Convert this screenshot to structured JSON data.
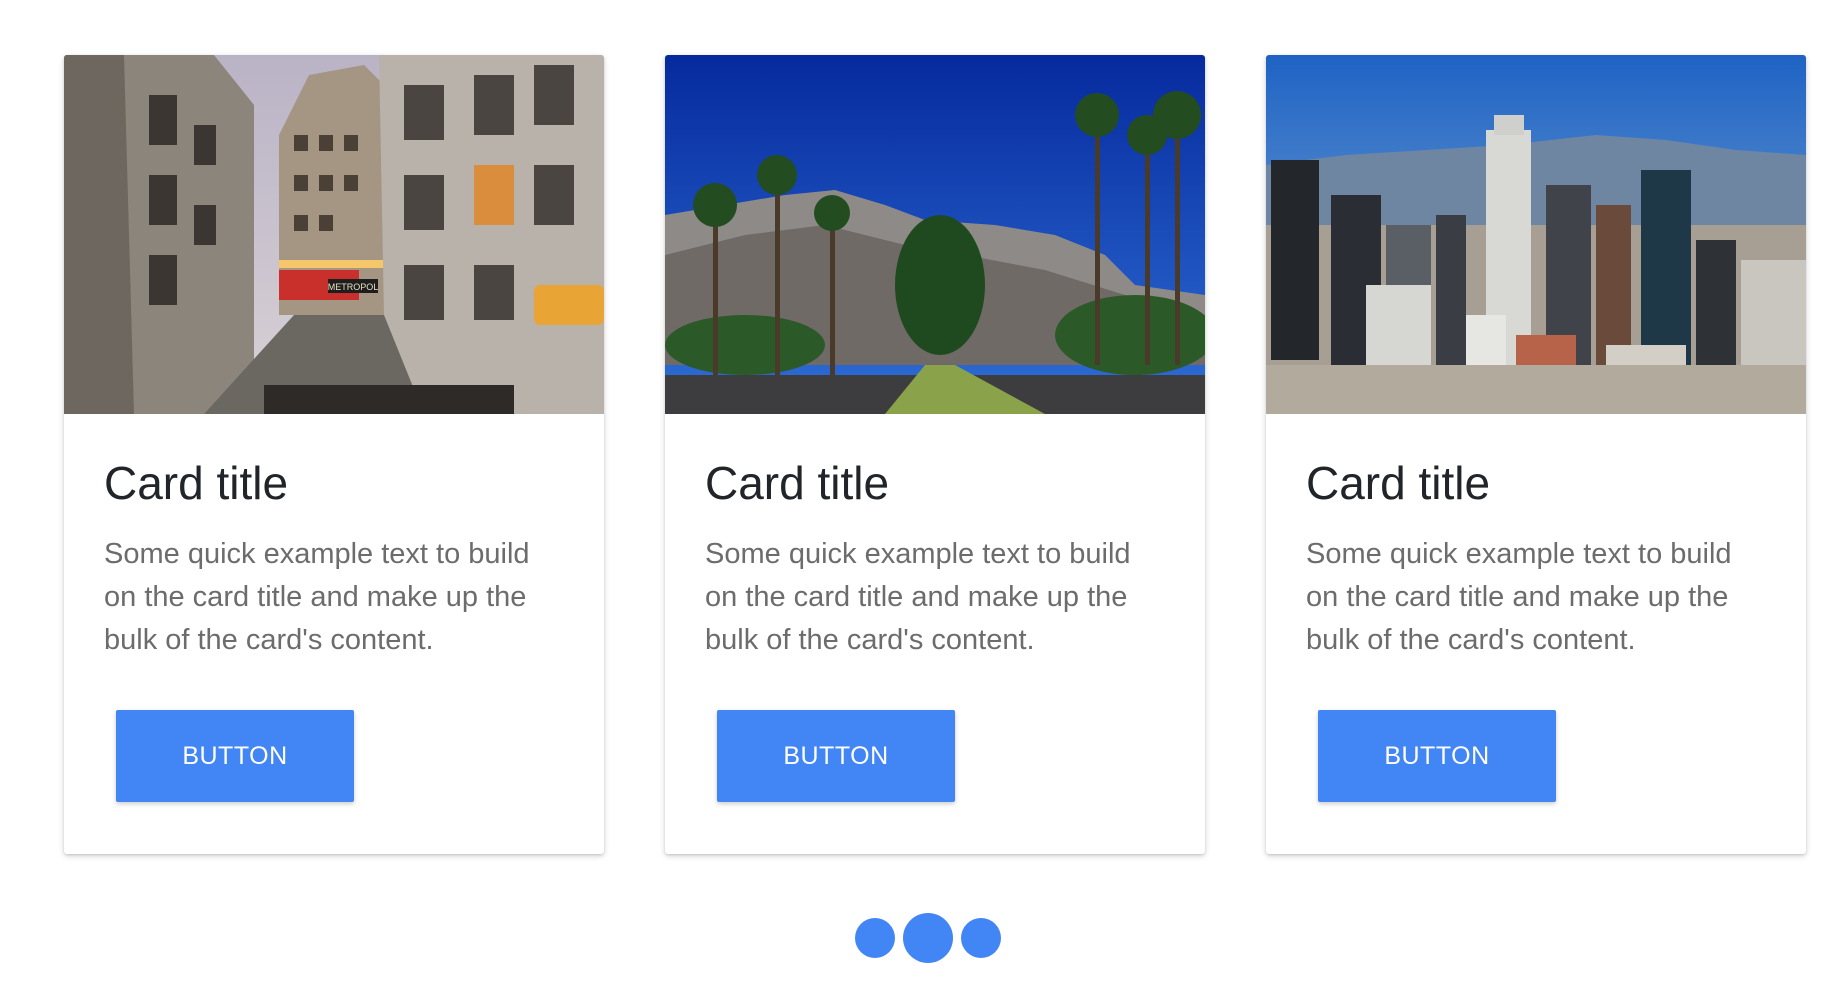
{
  "cards": [
    {
      "image_alt": "Paris street scene with Metropol sign",
      "image_sign": "METROPOL",
      "title": "Card title",
      "text": "Some quick example text to build on the card title and make up the bulk of the card's content.",
      "button_label": "BUTTON"
    },
    {
      "image_alt": "Palm tree lined road with mountains",
      "title": "Card title",
      "text": "Some quick example text to build on the card title and make up the bulk of the card's content.",
      "button_label": "BUTTON"
    },
    {
      "image_alt": "City skyline with skyscrapers",
      "title": "Card title",
      "text": "Some quick example text to build on the card title and make up the bulk of the card's content.",
      "button_label": "BUTTON"
    }
  ],
  "pager": {
    "count": 3,
    "active_index": 1
  },
  "colors": {
    "accent": "#4285f4",
    "title": "#212529",
    "text": "#6c6c6c"
  }
}
